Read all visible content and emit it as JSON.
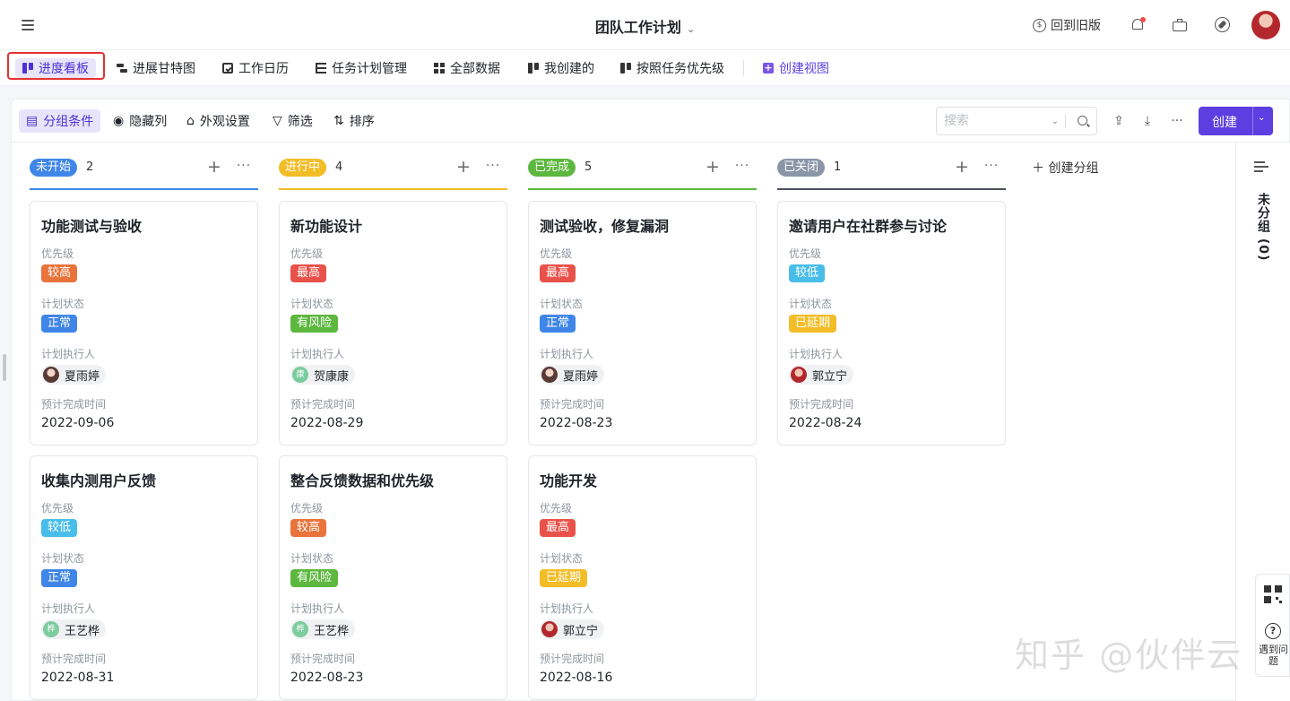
{
  "header": {
    "title": "团队工作计划",
    "back_to_old": "回到旧版",
    "coin_symbol": "$"
  },
  "view_tabs": [
    {
      "label": "进度看板",
      "icon": "kanban-icon",
      "active": true
    },
    {
      "label": "进展甘特图",
      "icon": "gantt-icon"
    },
    {
      "label": "工作日历",
      "icon": "calendar-icon"
    },
    {
      "label": "任务计划管理",
      "icon": "table-icon"
    },
    {
      "label": "全部数据",
      "icon": "grid-icon"
    },
    {
      "label": "我创建的",
      "icon": "kanban-icon"
    },
    {
      "label": "按照任务优先级",
      "icon": "kanban-icon"
    },
    {
      "label": "创建视图",
      "icon": "plus-square-icon"
    }
  ],
  "toolbar": {
    "group_by": "分组条件",
    "hide_columns": "隐藏列",
    "appearance": "外观设置",
    "filter": "筛选",
    "sort": "排序",
    "search_placeholder": "搜索",
    "create": "创建"
  },
  "field_labels": {
    "priority": "优先级",
    "plan_status": "计划状态",
    "assignee": "计划执行人",
    "due": "预计完成时间"
  },
  "colors": {
    "accent": "#5b3fe0",
    "status_not_started": "#3f86e8",
    "status_in_progress": "#f2bd27",
    "status_done": "#5cb83e",
    "status_closed": "#8a96a8",
    "priority_high": "#e8743b",
    "priority_highest": "#e9524a",
    "priority_low": "#49bdea",
    "plan_normal": "#3f86e8",
    "plan_risk": "#5cb83e",
    "plan_delayed": "#f2bd27"
  },
  "columns": [
    {
      "status": "未开始",
      "count": "2",
      "cards": [
        {
          "title": "功能测试与验收",
          "priority": "较高",
          "plan": "正常",
          "assignee": "夏雨婷",
          "avatar": "",
          "date": "2022-09-06"
        },
        {
          "title": "收集内测用户反馈",
          "priority": "较低",
          "plan": "正常",
          "assignee": "王艺桦",
          "avatar": "桦",
          "date": "2022-08-31"
        }
      ]
    },
    {
      "status": "进行中",
      "count": "4",
      "cards": [
        {
          "title": "新功能设计",
          "priority": "最高",
          "plan": "有风险",
          "assignee": "贺康康",
          "avatar": "康",
          "date": "2022-08-29"
        },
        {
          "title": "整合反馈数据和优先级",
          "priority": "较高",
          "plan": "有风险",
          "assignee": "王艺桦",
          "avatar": "桦",
          "date": "2022-08-23"
        }
      ]
    },
    {
      "status": "已完成",
      "count": "5",
      "cards": [
        {
          "title": "测试验收，修复漏洞",
          "priority": "最高",
          "plan": "正常",
          "assignee": "夏雨婷",
          "avatar": "",
          "date": "2022-08-23"
        },
        {
          "title": "功能开发",
          "priority": "最高",
          "plan": "已延期",
          "assignee": "郭立宁",
          "avatar": "",
          "date": "2022-08-16"
        }
      ]
    },
    {
      "status": "已关闭",
      "count": "1",
      "cards": [
        {
          "title": "邀请用户在社群参与讨论",
          "priority": "较低",
          "plan": "已延期",
          "assignee": "郭立宁",
          "avatar": "",
          "date": "2022-08-24"
        }
      ]
    }
  ],
  "create_group": "创建分组",
  "ungrouped": "未分组 (0)",
  "help": "遇到问题",
  "watermark": "知乎 @伙伴云"
}
